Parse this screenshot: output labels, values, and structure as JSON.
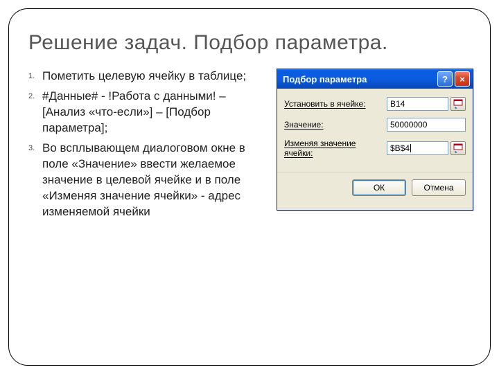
{
  "slide": {
    "title": "Решение задач. Подбор параметра.",
    "items": [
      {
        "n": "1.",
        "text": "Пометить целевую ячейку в таблице;"
      },
      {
        "n": "2.",
        "text": "#Данные# - !Работа с данными! – [Анализ «что-если»] – [Подбор параметра];"
      },
      {
        "n": "3.",
        "text": "Во всплывающем диалоговом окне в поле «Значение» ввести желаемое значение в целевой ячейке и в поле «Изменяя значение ячейки» - адрес изменяемой ячейки"
      }
    ]
  },
  "dialog": {
    "title": "Подбор параметра",
    "help_tooltip": "?",
    "close_tooltip": "×",
    "rows": {
      "set_cell": {
        "label": "Установить в ячейке:",
        "value": "B14"
      },
      "to_value": {
        "label": "Значение:",
        "value": "50000000"
      },
      "by_changing": {
        "label": "Изменяя значение ячейки:",
        "value": "$B$4"
      }
    },
    "buttons": {
      "ok": "ОК",
      "cancel": "Отмена"
    }
  }
}
